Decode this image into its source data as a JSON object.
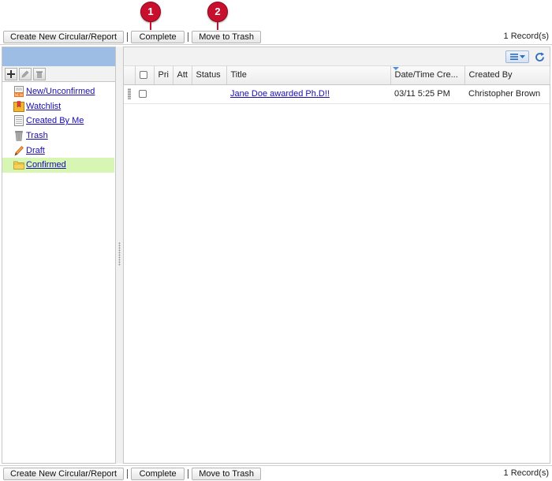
{
  "callouts": [
    "1",
    "2"
  ],
  "toolbar": {
    "create_label": "Create New Circular/Report",
    "complete_label": "Complete",
    "trash_label": "Move to Trash",
    "records": "1 Record(s)"
  },
  "folders": [
    {
      "label": "New/Unconfirmed",
      "icon": "new-document-icon"
    },
    {
      "label": "Watchlist",
      "icon": "watchlist-folder-icon"
    },
    {
      "label": "Created By Me",
      "icon": "document-icon"
    },
    {
      "label": "Trash",
      "icon": "trash-icon"
    },
    {
      "label": "Draft",
      "icon": "pencil-icon"
    },
    {
      "label": "Confirmed",
      "icon": "folder-icon",
      "selected": true
    }
  ],
  "grid": {
    "columns": [
      "",
      "",
      "Pri",
      "Att",
      "Status",
      "Title",
      "Date/Time Cre...",
      "Created By"
    ],
    "rows": [
      {
        "pri": "",
        "att": "",
        "status": "",
        "title": "Jane Doe awarded Ph.D!!",
        "datetime": "03/11 5:25 PM",
        "created_by": "Christopher Brown"
      }
    ]
  },
  "colors": {
    "pane_header": "#9dbde4",
    "selected_row": "#d7f5b3",
    "link": "#1a0dab",
    "callout": "#c8102e"
  }
}
